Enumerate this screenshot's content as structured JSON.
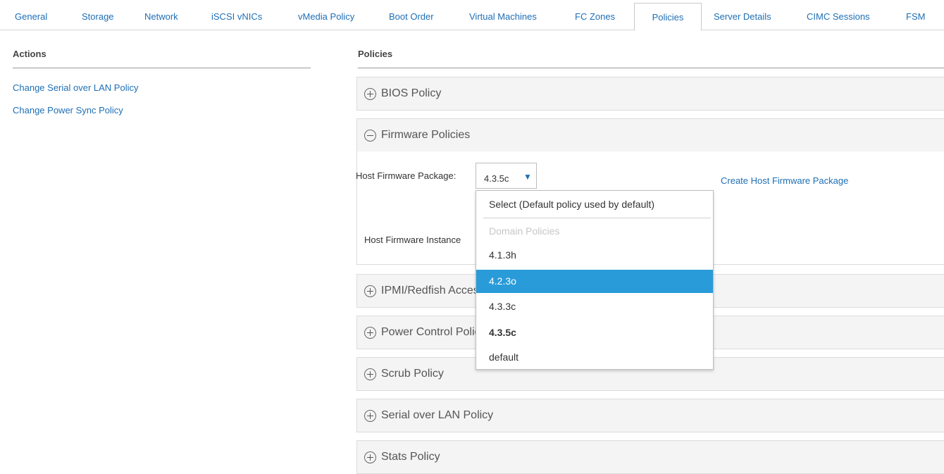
{
  "tabs": [
    {
      "label": "General",
      "active": false
    },
    {
      "label": "Storage",
      "active": false
    },
    {
      "label": "Network",
      "active": false
    },
    {
      "label": "iSCSI vNICs",
      "active": false
    },
    {
      "label": "vMedia Policy",
      "active": false
    },
    {
      "label": "Boot Order",
      "active": false
    },
    {
      "label": "Virtual Machines",
      "active": false
    },
    {
      "label": "FC Zones",
      "active": false
    },
    {
      "label": "Policies",
      "active": true
    },
    {
      "label": "Server Details",
      "active": false
    },
    {
      "label": "CIMC Sessions",
      "active": false
    },
    {
      "label": "FSM",
      "active": false
    }
  ],
  "actions": {
    "title": "Actions",
    "links": [
      "Change Serial over LAN Policy",
      "Change Power Sync Policy"
    ]
  },
  "policies": {
    "title": "Policies",
    "panels": [
      {
        "label": "BIOS Policy",
        "expanded": false
      },
      {
        "label": "Firmware Policies",
        "expanded": true
      },
      {
        "label": "IPMI/Redfish Access Profile Policy",
        "expanded": false
      },
      {
        "label": "Power Control Policy",
        "expanded": false
      },
      {
        "label": "Scrub Policy",
        "expanded": false
      },
      {
        "label": "Serial over LAN Policy",
        "expanded": false
      },
      {
        "label": "Stats Policy",
        "expanded": false
      }
    ],
    "firmware": {
      "host_package_label": "Host Firmware Package:",
      "selected_value": "4.3.5c",
      "dropdown_arrow": "▼",
      "create_link": "Create Host Firmware Package",
      "instance_label": "Host Firmware Instance"
    }
  },
  "dropdown": {
    "options": [
      {
        "label": "Select (Default policy used by default)",
        "kind": "option"
      },
      {
        "label": "Domain Policies",
        "kind": "group"
      },
      {
        "label": "4.1.3h",
        "kind": "option"
      },
      {
        "label": "4.2.3o",
        "kind": "option",
        "highlighted": true
      },
      {
        "label": "4.3.3c",
        "kind": "option"
      },
      {
        "label": "4.3.5c",
        "kind": "option",
        "current": true
      },
      {
        "label": "default",
        "kind": "option"
      }
    ]
  },
  "colors": {
    "link": "#1e6fb5",
    "highlight": "#2a9bd9",
    "panel_header": "#f4f4f4"
  },
  "icons": {
    "collapsed": "plus-circle-icon",
    "expanded": "minus-circle-icon",
    "select_arrow": "triangle-down-icon"
  }
}
